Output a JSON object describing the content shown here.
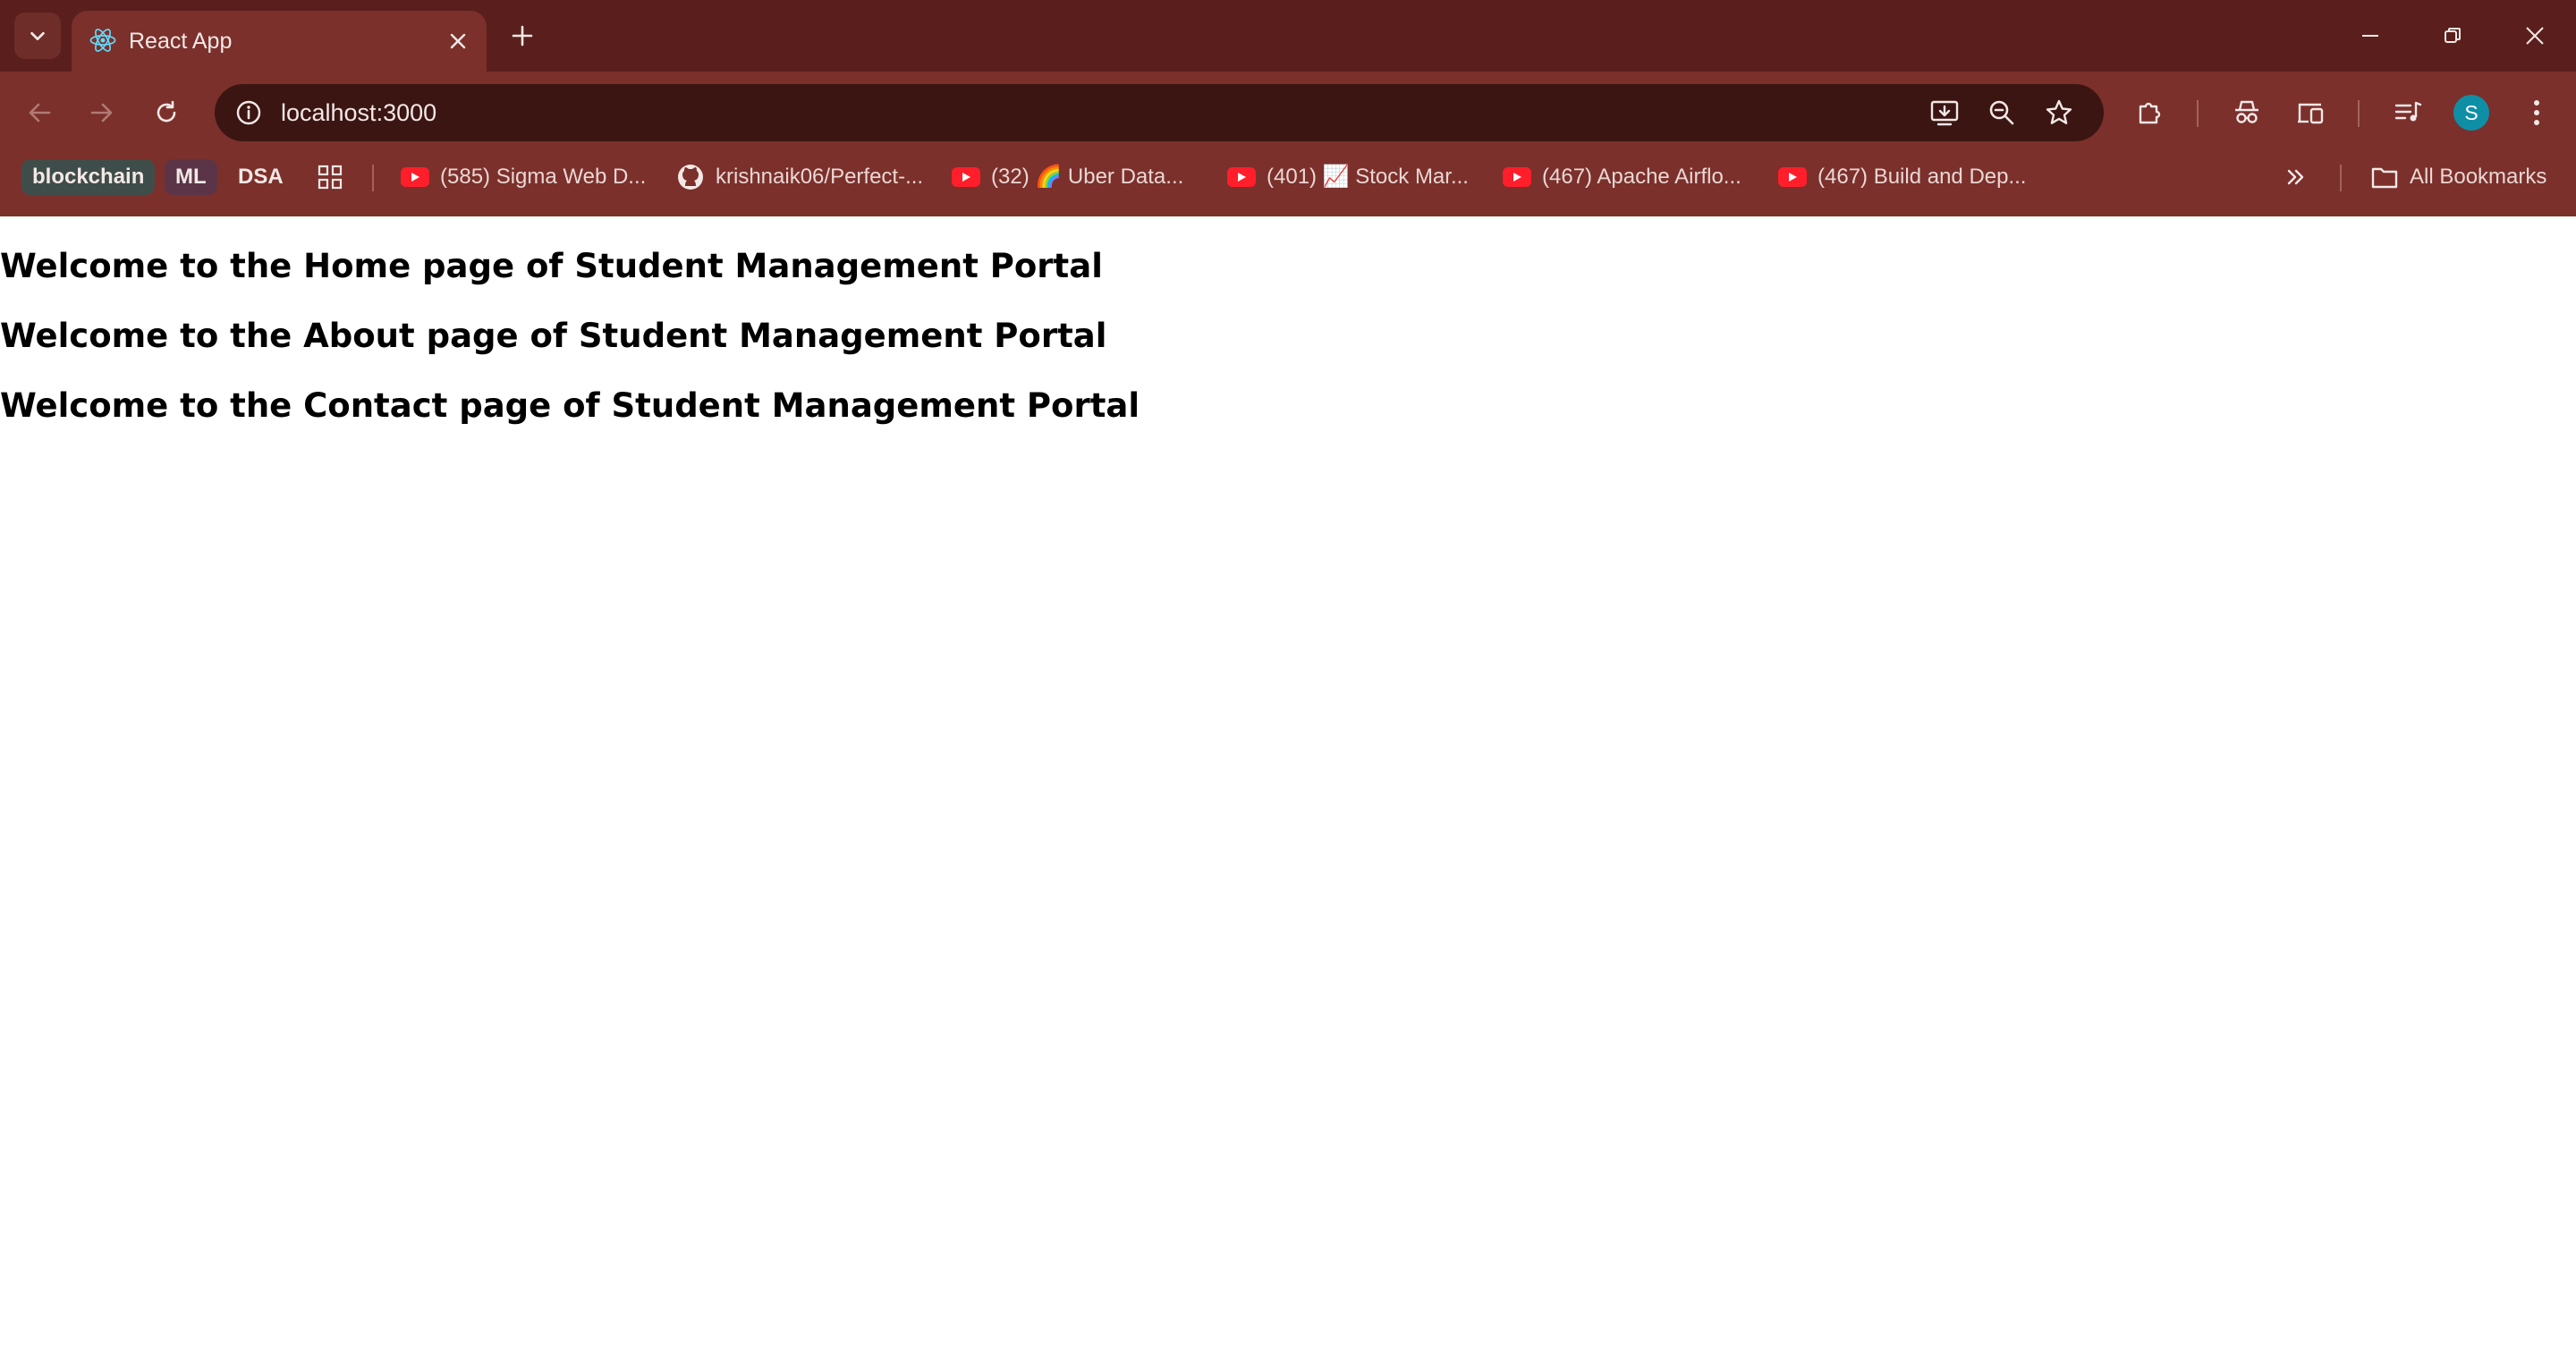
{
  "browser": {
    "tab": {
      "title": "React App",
      "favicon": "react-icon"
    },
    "address_bar": {
      "url": "localhost:3000"
    },
    "profile_initial": "S",
    "theme_colors": {
      "frame": "#5a1f1c",
      "toolbar": "#7b302b",
      "omnibox": "#3b1512",
      "avatar": "#0e8fa6"
    }
  },
  "bookmarks": {
    "folders": [
      {
        "label": "blockchain"
      },
      {
        "label": "ML"
      },
      {
        "label": "DSA"
      }
    ],
    "items": [
      {
        "label": "(585) Sigma Web D...",
        "icon": "youtube-icon"
      },
      {
        "label": "krishnaik06/Perfect-...",
        "icon": "github-icon"
      },
      {
        "label": "(32) 🌈 Uber Data...",
        "icon": "youtube-icon"
      },
      {
        "label": "(401) 📈 Stock Mar...",
        "icon": "youtube-icon"
      },
      {
        "label": "(467) Apache Airflo...",
        "icon": "youtube-icon"
      },
      {
        "label": "(467) Build and Dep...",
        "icon": "youtube-icon"
      }
    ],
    "all_bookmarks": "All Bookmarks"
  },
  "page": {
    "headings": [
      "Welcome to the Home page of Student Management Portal",
      "Welcome to the About page of Student Management Portal",
      "Welcome to the Contact page of Student Management Portal"
    ]
  }
}
